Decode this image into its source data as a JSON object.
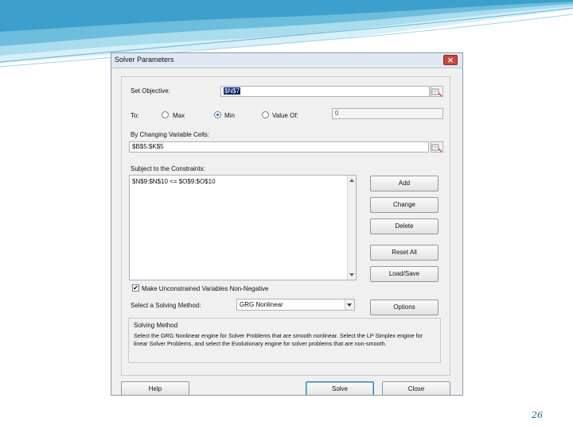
{
  "dialog": {
    "title": "Solver Parameters",
    "close_glyph": "✕",
    "set_objective_label": "Set Objective:",
    "objective_value": "$N$7",
    "to_label": "To:",
    "radio_max": "Max",
    "radio_min": "Min",
    "radio_value_of": "Value Of:",
    "selected_radio": "Min",
    "value_of_value": "0",
    "changing_cells_label": "By Changing Variable Cells:",
    "changing_cells_value": "$B$5:$K$5",
    "constraints_label": "Subject to the Constraints:",
    "constraints": [
      "$N$9:$N$10 <= $O$9:$O$10"
    ],
    "buttons": {
      "add": "Add",
      "change": "Change",
      "delete": "Delete",
      "reset_all": "Reset All",
      "load_save": "Load/Save",
      "options": "Options",
      "help": "Help",
      "solve": "Solve",
      "close": "Close"
    },
    "nonnegative_label": "Make Unconstrained Variables Non-Negative",
    "nonnegative_checked": true,
    "solving_method_label": "Select a Solving Method:",
    "solving_method_value": "GRG Nonlinear",
    "solving_method_group_title": "Solving Method",
    "solving_method_description": "Select the GRG Nonlinear engine for Solver Problems that are smooth nonlinear. Select the LP Simplex engine for linear Solver Problems, and select the Evolutionary engine for solver problems that are non-smooth."
  },
  "slide_number": "26",
  "colors": {
    "wave_light": "#d4eef8",
    "wave_mid": "#8fcfe6",
    "wave_dark": "#4aa7cf"
  },
  "icons": [
    "range-selector-icon",
    "close-icon",
    "checkmark-icon",
    "dropdown-arrow-icon"
  ]
}
